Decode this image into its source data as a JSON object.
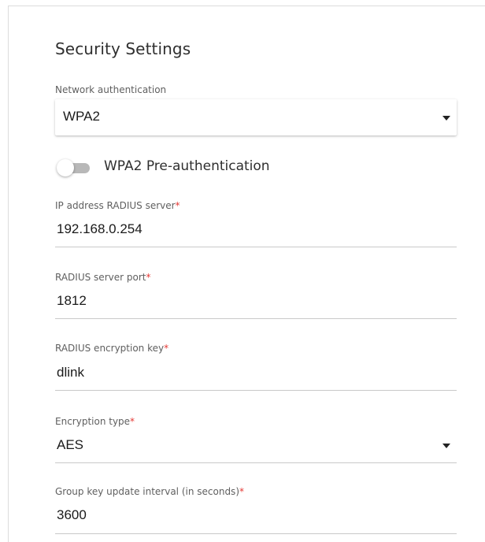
{
  "section": {
    "title": "Security Settings"
  },
  "network_auth": {
    "label": "Network authentication",
    "value": "WPA2"
  },
  "preauth": {
    "label": "WPA2 Pre-authentication",
    "enabled": false
  },
  "radius_ip": {
    "label": "IP address RADIUS server",
    "required_mark": "*",
    "value": "192.168.0.254"
  },
  "radius_port": {
    "label": "RADIUS server port",
    "required_mark": "*",
    "value": "1812"
  },
  "radius_key": {
    "label": "RADIUS encryption key",
    "required_mark": "*",
    "value": "dlink"
  },
  "encryption": {
    "label": "Encryption type",
    "required_mark": "*",
    "value": "AES"
  },
  "group_key": {
    "label": "Group key update interval (in seconds)",
    "required_mark": "*",
    "value": "3600"
  },
  "colors": {
    "required": "#e53935",
    "toggle_track_off": "#b8b8b8",
    "underline": "#c9c9c9"
  },
  "icons": {
    "dropdown": "caret-down-icon"
  }
}
